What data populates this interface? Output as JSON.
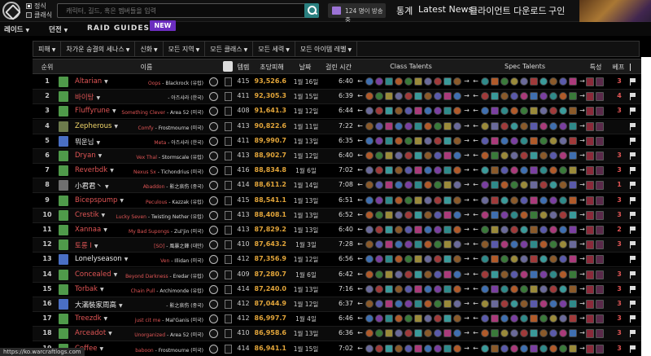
{
  "header": {
    "radio_official": "정식",
    "radio_classic": "클래식",
    "search_placeholder": "캐릭터, 길드, 혹은 멤버들을 입력",
    "twitch_label": "124 명이 방송중",
    "nav": [
      "통계",
      "Latest News",
      "클라이언트 다운로드",
      "구인"
    ]
  },
  "menubar": {
    "items": [
      "레이드",
      "던전",
      "RAID GUIDES"
    ],
    "new_badge": "NEW"
  },
  "filters": [
    "피해",
    "차가운 숭결의 세나스",
    "신화",
    "모든 지역",
    "모든 클래스",
    "모든 세력",
    "모든 아이템 레벨"
  ],
  "table": {
    "headers": {
      "rank": "순위",
      "name": "이름",
      "ilvl": "템렙",
      "dps": "초당피해",
      "date": "날짜",
      "duration": "걸린 시간",
      "class_talents": "Class Talents",
      "spec_talents": "Spec Talents",
      "traits": "특성",
      "best": "베프"
    },
    "rows": [
      {
        "rank": "1",
        "name": "Altarian",
        "name_color": "#e05555",
        "avatar": "#4f9a4a",
        "guild": "Oops",
        "realm": "Blackrock (유럽)",
        "ilvl": "415",
        "dps": "93,526.6",
        "date": "1월 16일",
        "duration": "6:40",
        "best": "3"
      },
      {
        "rank": "2",
        "name": "바이탕",
        "name_color": "#e05555",
        "avatar": "#4f9a4a",
        "guild": "",
        "realm": "아즈샤라 (한국)",
        "ilvl": "411",
        "dps": "92,305.3",
        "date": "1월 15일",
        "duration": "6:39",
        "best": "4"
      },
      {
        "rank": "3",
        "name": "Fluffyrune",
        "name_color": "#e05555",
        "avatar": "#4f9a4a",
        "guild": "Something Clever",
        "realm": "Area 52 (미국)",
        "ilvl": "408",
        "dps": "91,641.3",
        "date": "1월 12일",
        "duration": "6:44",
        "best": "3"
      },
      {
        "rank": "4",
        "name": "Zepherous",
        "name_color": "#f2d76b",
        "avatar": "#6d7b4c",
        "guild": "Comfy",
        "realm": "Frostmourne (미국)",
        "ilvl": "413",
        "dps": "90,822.6",
        "date": "1월 11일",
        "duration": "7:22",
        "best": ""
      },
      {
        "rank": "5",
        "name": "뭐운님",
        "name_color": "#e9e9e9",
        "avatar": "#4a6fc4",
        "guild": "Meta",
        "realm": "아즈샤라 (한국)",
        "ilvl": "411",
        "dps": "89,990.7",
        "date": "1월 13일",
        "duration": "6:35",
        "best": ""
      },
      {
        "rank": "6",
        "name": "Dryan",
        "name_color": "#e05555",
        "avatar": "#4f9a4a",
        "guild": "Vex Thal",
        "realm": "Stormscale (유럽)",
        "ilvl": "413",
        "dps": "88,902.7",
        "date": "1월 12일",
        "duration": "6:40",
        "best": "3"
      },
      {
        "rank": "7",
        "name": "Reverbdk",
        "name_color": "#e05555",
        "avatar": "#4f9a4a",
        "guild": "Nexus Sx",
        "realm": "Tichondrius (미국)",
        "ilvl": "416",
        "dps": "88,834.8",
        "date": "1월 6일",
        "duration": "7:02",
        "best": "3"
      },
      {
        "rank": "8",
        "name": "小君君丶",
        "name_color": "#e9e9e9",
        "avatar": "#6f6f6f",
        "guild": "Abaddon",
        "realm": "影之哀伤 (중국)",
        "ilvl": "414",
        "dps": "88,611.2",
        "date": "1월 14일",
        "duration": "7:08",
        "best": "1"
      },
      {
        "rank": "9",
        "name": "Bicepspump",
        "name_color": "#e05555",
        "avatar": "#4f9a4a",
        "guild": "Peculous",
        "realm": "Kazzak (유럽)",
        "ilvl": "415",
        "dps": "88,541.1",
        "date": "1월 13일",
        "duration": "6:51",
        "best": "3"
      },
      {
        "rank": "10",
        "name": "Crestik",
        "name_color": "#e05555",
        "avatar": "#4f9a4a",
        "guild": "Lucky Seven",
        "realm": "Twisting Nether (유럽)",
        "ilvl": "413",
        "dps": "88,408.1",
        "date": "1월 13일",
        "duration": "6:52",
        "best": "3"
      },
      {
        "rank": "11",
        "name": "Xannaa",
        "name_color": "#e05555",
        "avatar": "#4f9a4a",
        "guild": "My Bad Supongs",
        "realm": "Zul'jin (미국)",
        "ilvl": "413",
        "dps": "87,829.2",
        "date": "1월 13일",
        "duration": "6:40",
        "best": "2"
      },
      {
        "rank": "12",
        "name": "토롱 I",
        "name_color": "#e05555",
        "avatar": "#4f9a4a",
        "guild": "[SO]",
        "realm": "風暴之鋒 (대만)",
        "ilvl": "410",
        "dps": "87,643.2",
        "date": "1월 3일",
        "duration": "7:28",
        "best": "3"
      },
      {
        "rank": "13",
        "name": "Lonelyseason",
        "name_color": "#e9e9e9",
        "avatar": "#4a6fc4",
        "guild": "Ven",
        "realm": "Illidan (미국)",
        "ilvl": "412",
        "dps": "87,356.9",
        "date": "1월 12일",
        "duration": "6:56",
        "best": ""
      },
      {
        "rank": "14",
        "name": "Concealed",
        "name_color": "#e05555",
        "avatar": "#4f9a4a",
        "guild": "Beyond Darkness",
        "realm": "Eredar (유럽)",
        "ilvl": "409",
        "dps": "87,280.7",
        "date": "1월 6일",
        "duration": "6:42",
        "best": "3"
      },
      {
        "rank": "15",
        "name": "Torbak",
        "name_color": "#e05555",
        "avatar": "#4f9a4a",
        "guild": "Chain Pull",
        "realm": "Archimonde (유럽)",
        "ilvl": "414",
        "dps": "87,240.0",
        "date": "1월 13일",
        "duration": "7:16",
        "best": "3"
      },
      {
        "rank": "16",
        "name": "大滿裝家周高",
        "name_color": "#e9e9e9",
        "avatar": "#4a6fc4",
        "guild": "",
        "realm": "影之哀伤 (중국)",
        "ilvl": "412",
        "dps": "87,044.9",
        "date": "1월 12일",
        "duration": "6:37",
        "best": "3"
      },
      {
        "rank": "17",
        "name": "Treezdk",
        "name_color": "#e05555",
        "avatar": "#4f9a4a",
        "guild": "just cit me",
        "realm": "Mal'Ganis (미국)",
        "ilvl": "412",
        "dps": "86,997.7",
        "date": "1월 4일",
        "duration": "6:46",
        "best": "3"
      },
      {
        "rank": "18",
        "name": "Arceadot",
        "name_color": "#e05555",
        "avatar": "#4f9a4a",
        "guild": "Unorganized",
        "realm": "Area 52 (미국)",
        "ilvl": "410",
        "dps": "86,958.6",
        "date": "1월 13일",
        "duration": "6:36",
        "best": "3"
      },
      {
        "rank": "19",
        "name": "Coffee",
        "name_color": "#e05555",
        "avatar": "#4f9a4a",
        "guild": "baboon",
        "realm": "Frostmourne (미국)",
        "ilvl": "414",
        "dps": "86,941.1",
        "date": "1월 15일",
        "duration": "7:02",
        "best": "3"
      }
    ]
  },
  "status_url": "https://ko.warcraftlogs.com"
}
